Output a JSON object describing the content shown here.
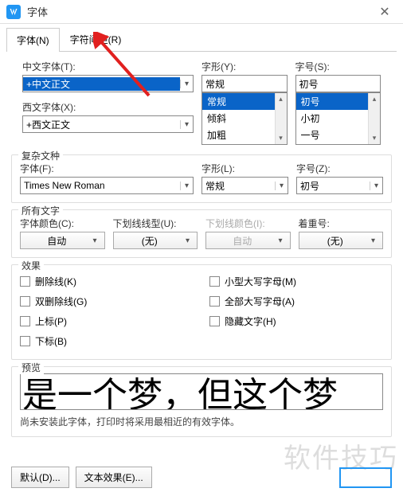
{
  "window": {
    "title": "字体",
    "close": "✕"
  },
  "tabs": {
    "font": "字体(N)",
    "spacing": "字符间距(R)"
  },
  "chinese": {
    "label": "中文字体(T):",
    "value": "+中文正文",
    "shape_label": "字形(Y):",
    "shape_value": "常规",
    "shape_options_visible": [
      "常规",
      "倾斜",
      "加粗"
    ],
    "size_label": "字号(S):",
    "size_value": "初号",
    "size_options_visible": [
      "初号",
      "小初",
      "一号"
    ]
  },
  "western": {
    "label": "西文字体(X):",
    "value": "+西文正文"
  },
  "complex": {
    "group": "复杂文种",
    "font_label": "字体(F):",
    "font_value": "Times New Roman",
    "shape_label": "字形(L):",
    "shape_value": "常规",
    "size_label": "字号(Z):",
    "size_value": "初号"
  },
  "alltext": {
    "group": "所有文字",
    "color_label": "字体颜色(C):",
    "color_value": "自动",
    "underline_label": "下划线线型(U):",
    "underline_value": "(无)",
    "underline_color_label": "下划线颜色(I):",
    "underline_color_value": "自动",
    "emphasis_label": "着重号:",
    "emphasis_value": "(无)"
  },
  "effects": {
    "group": "效果",
    "strike": "删除线(K)",
    "dstrike": "双删除线(G)",
    "sup": "上标(P)",
    "sub": "下标(B)",
    "smallcaps": "小型大写字母(M)",
    "allcaps": "全部大写字母(A)",
    "hidden": "隐藏文字(H)"
  },
  "preview": {
    "group": "预览",
    "text": "是一个梦，但这个梦",
    "note": "尚未安装此字体，打印时将采用最相近的有效字体。"
  },
  "footer": {
    "default": "默认(D)...",
    "texteffects": "文本效果(E)..."
  },
  "watermark": "软件技巧"
}
